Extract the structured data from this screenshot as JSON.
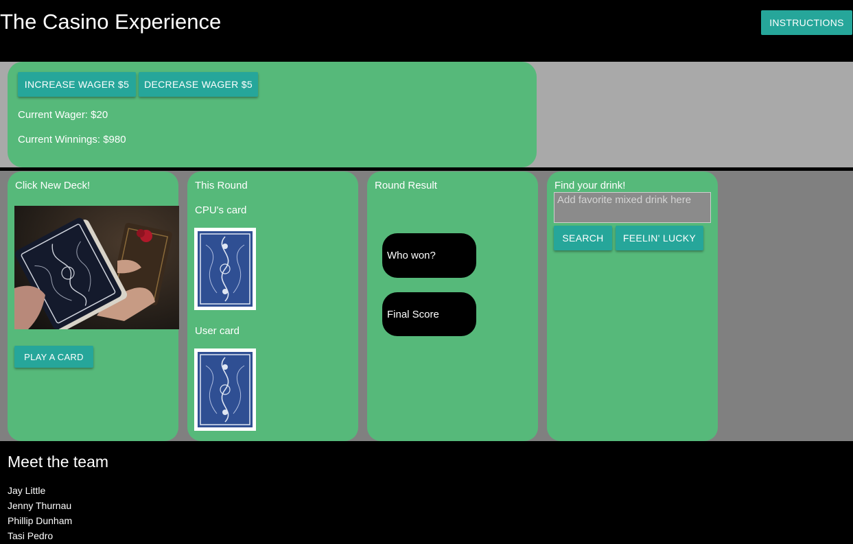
{
  "header": {
    "title": "The Casino Experience",
    "instructions_label": "INSTRUCTIONS"
  },
  "wager": {
    "increase_label": "INCREASE WAGER $5",
    "decrease_label": "DECREASE WAGER $5",
    "current_wager": "Current Wager: $20",
    "current_winnings": "Current Winnings: $980"
  },
  "deck_panel": {
    "title": "Click New Deck!",
    "play_label": "PLAY A CARD"
  },
  "round_panel": {
    "title": "This Round",
    "cpu_label": "CPU's card",
    "user_label": "User card"
  },
  "result_panel": {
    "title": "Round Result",
    "who_won": "Who won?",
    "final_score": "Final Score"
  },
  "drink_panel": {
    "title": "Find your drink!",
    "placeholder": "Add favorite mixed drink here",
    "search_label": "SEARCH",
    "lucky_label": "FEELIN' LUCKY"
  },
  "team": {
    "title": "Meet the team",
    "members": [
      "Jay Little",
      "Jenny Thurnau",
      "Phillip Dunham",
      "Tasi Pedro"
    ]
  },
  "colors": {
    "panel_green": "#56b97a",
    "button_teal": "#26a69a",
    "card_blue": "#2f4f93"
  }
}
